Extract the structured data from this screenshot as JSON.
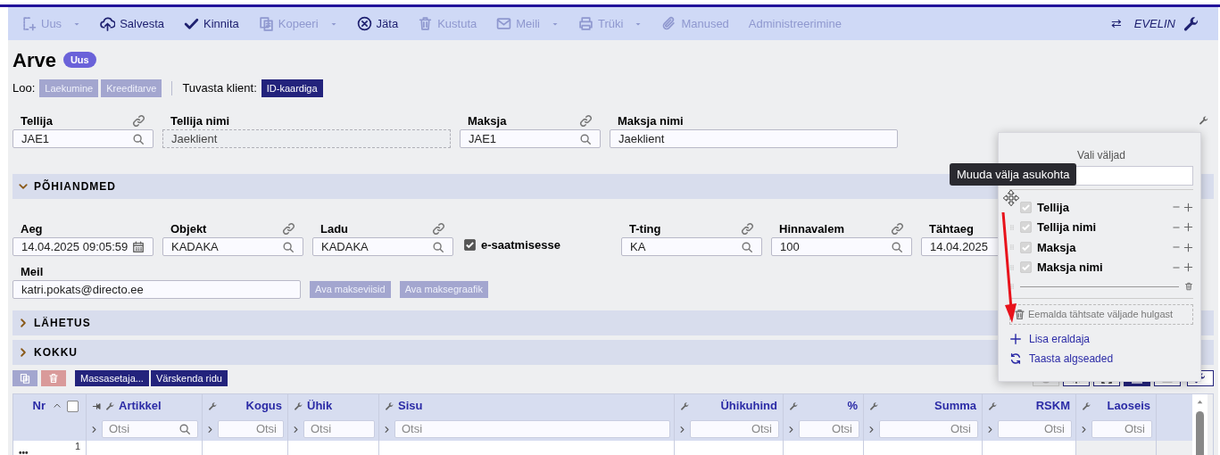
{
  "toolbar": {
    "items": [
      {
        "label": "Uus",
        "kind": "new",
        "disabled": true,
        "dropdown": true
      },
      {
        "label": "Salvesta",
        "kind": "upload",
        "disabled": false,
        "dropdown": false
      },
      {
        "label": "Kinnita",
        "kind": "check",
        "disabled": false,
        "dropdown": false
      },
      {
        "label": "Kopeeri",
        "kind": "copy",
        "disabled": true,
        "dropdown": true
      },
      {
        "label": "Jäta",
        "kind": "cancel",
        "disabled": false,
        "dropdown": false
      },
      {
        "label": "Kustuta",
        "kind": "trash",
        "disabled": true,
        "dropdown": false
      },
      {
        "label": "Meili",
        "kind": "mail",
        "disabled": true,
        "dropdown": true
      },
      {
        "label": "Trüki",
        "kind": "print",
        "disabled": true,
        "dropdown": true
      },
      {
        "label": "Manused",
        "kind": "clip",
        "disabled": true,
        "dropdown": false
      },
      {
        "label": "Administreerimine",
        "kind": "none",
        "disabled": true,
        "dropdown": false
      }
    ],
    "swap": "⇄",
    "user": "EVELIN"
  },
  "title": "Arve",
  "badge": "Uus",
  "create": {
    "label": "Loo:",
    "buttons": [
      {
        "label": "Laekumine",
        "disabled": true
      },
      {
        "label": "Kreeditarve",
        "disabled": true
      }
    ]
  },
  "verify": {
    "label": "Tuvasta klient:",
    "buttons": [
      {
        "label": "ID-kaardiga",
        "disabled": false
      }
    ]
  },
  "header_fields": [
    {
      "label": "Tellija",
      "value": "JAE1",
      "kind": "lookup",
      "link": true
    },
    {
      "label": "Tellija nimi",
      "value": "Jaeklient",
      "kind": "readonly",
      "link": false
    },
    {
      "label": "Maksja",
      "value": "JAE1",
      "kind": "lookup",
      "link": true
    },
    {
      "label": "Maksja nimi",
      "value": "Jaeklient",
      "kind": "text",
      "link": false
    }
  ],
  "sections": [
    {
      "title": "PÕHIANDMED",
      "expanded": true,
      "fields": [
        {
          "label": "Aeg",
          "value": "14.04.2025 09:05:59",
          "kind": "date",
          "link": false
        },
        {
          "label": "Objekt",
          "value": "KADAKA",
          "kind": "lookup",
          "link": true
        },
        {
          "label": "Ladu",
          "value": "KADAKA",
          "kind": "lookup",
          "link": true
        },
        {
          "label": "e-saatmisesse",
          "kind": "checkbox",
          "checked": true
        },
        {
          "label": "T-ting",
          "value": "KA",
          "kind": "lookup",
          "link": true
        },
        {
          "label": "Hinnavalem",
          "value": "100",
          "kind": "lookup",
          "link": true
        },
        {
          "label": "Tähtaeg",
          "value": "14.04.2025",
          "kind": "plain",
          "link": false
        }
      ],
      "email": {
        "label": "Meil",
        "value": "katri.pokats@directo.ee",
        "kind": "text",
        "link": false
      },
      "buttons": [
        {
          "label": "Ava makseviisid",
          "disabled": true
        },
        {
          "label": "Ava maksegraafik",
          "disabled": true
        }
      ]
    },
    {
      "title": "LÄHETUS",
      "expanded": false
    },
    {
      "title": "KOKKU",
      "expanded": false
    }
  ],
  "rows_toolbar": {
    "buttons": [
      "Massasetaja...",
      "Värskenda ridu"
    ]
  },
  "table": {
    "select_all": {
      "checked": false
    },
    "columns": [
      {
        "label": "Nr",
        "kind": "nr"
      },
      {
        "label": "Artikkel",
        "kind": "pinned",
        "filter": "Otsi",
        "search": true
      },
      {
        "label": "Kogus",
        "kind": "right",
        "filter": "Otsi",
        "search": false
      },
      {
        "label": "Ühik",
        "kind": "left",
        "filter": "Otsi",
        "search": false
      },
      {
        "label": "Sisu",
        "kind": "left",
        "filter": "Otsi",
        "search": false
      },
      {
        "label": "Ühikuhind",
        "kind": "right",
        "filter": "Otsi",
        "search": false
      },
      {
        "label": "%",
        "kind": "right",
        "filter": "Otsi",
        "search": false
      },
      {
        "label": "Summa",
        "kind": "right",
        "filter": "Otsi",
        "search": false
      },
      {
        "label": "RSKM",
        "kind": "right",
        "filter": "Otsi",
        "search": false
      },
      {
        "label": "Laoseis",
        "kind": "right",
        "filter": "Otsi",
        "search": false
      }
    ],
    "rows": [
      {
        "menu": "•••",
        "nr": "1"
      }
    ]
  },
  "field_picker": {
    "title": "Vali väljad",
    "items": [
      {
        "label": "Tellija",
        "checked": true
      },
      {
        "label": "Tellija nimi",
        "checked": true
      },
      {
        "label": "Maksja",
        "checked": true
      },
      {
        "label": "Maksja nimi",
        "checked": true
      }
    ],
    "remove": "Eemalda tähtsate väljade hulgast",
    "add": "Lisa eraldaja",
    "reset": "Taasta algseaded",
    "tooltip": "Muuda välja asukohta"
  }
}
